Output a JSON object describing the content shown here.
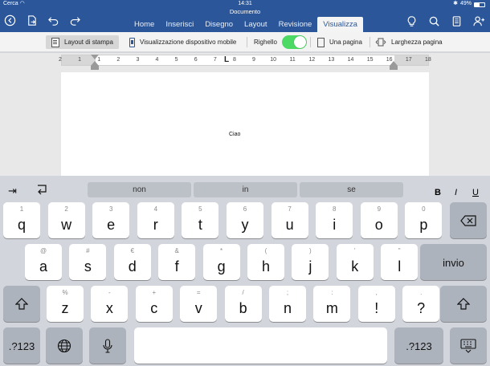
{
  "status": {
    "carrier": "Cerca",
    "time": "14:31",
    "battery": "49%"
  },
  "document": {
    "title": "Documento",
    "body_text": "Ciao"
  },
  "tabs": [
    {
      "label": "Home",
      "active": false
    },
    {
      "label": "Inserisci",
      "active": false
    },
    {
      "label": "Disegno",
      "active": false
    },
    {
      "label": "Layout",
      "active": false
    },
    {
      "label": "Revisione",
      "active": false
    },
    {
      "label": "Visualizza",
      "active": true
    }
  ],
  "ribbon": {
    "print_layout": "Layout di stampa",
    "mobile_view": "Visualizzazione dispositivo mobile",
    "ruler": "Righello",
    "ruler_on": true,
    "one_page": "Una pagina",
    "page_width": "Larghezza pagina"
  },
  "ruler_ticks": [
    "2",
    "1",
    "1",
    "2",
    "3",
    "4",
    "5",
    "6",
    "7",
    "8",
    "9",
    "10",
    "11",
    "12",
    "13",
    "14",
    "15",
    "16",
    "17",
    "18"
  ],
  "suggestions": [
    "non",
    "in",
    "se"
  ],
  "format_buttons": {
    "bold": "B",
    "italic": "I",
    "underline": "U"
  },
  "keys": {
    "row1": [
      {
        "main": "q",
        "alt": "1"
      },
      {
        "main": "w",
        "alt": "2"
      },
      {
        "main": "e",
        "alt": "3"
      },
      {
        "main": "r",
        "alt": "4"
      },
      {
        "main": "t",
        "alt": "5"
      },
      {
        "main": "y",
        "alt": "6"
      },
      {
        "main": "u",
        "alt": "7"
      },
      {
        "main": "i",
        "alt": "8"
      },
      {
        "main": "o",
        "alt": "9"
      },
      {
        "main": "p",
        "alt": "0"
      }
    ],
    "row2": [
      {
        "main": "a",
        "alt": "@"
      },
      {
        "main": "s",
        "alt": "#"
      },
      {
        "main": "d",
        "alt": "€"
      },
      {
        "main": "f",
        "alt": "&"
      },
      {
        "main": "g",
        "alt": "*"
      },
      {
        "main": "h",
        "alt": "("
      },
      {
        "main": "j",
        "alt": ")"
      },
      {
        "main": "k",
        "alt": "'"
      },
      {
        "main": "l",
        "alt": "\""
      }
    ],
    "row3": [
      {
        "main": "z",
        "alt": "%"
      },
      {
        "main": "x",
        "alt": "-"
      },
      {
        "main": "c",
        "alt": "+"
      },
      {
        "main": "v",
        "alt": "="
      },
      {
        "main": "b",
        "alt": "/"
      },
      {
        "main": "n",
        "alt": ";"
      },
      {
        "main": "m",
        "alt": ":"
      },
      {
        "main": "!",
        "alt": ","
      },
      {
        "main": "?",
        "alt": "."
      }
    ],
    "return_label": "invio",
    "numbers_label": ".?123"
  },
  "colors": {
    "accent": "#2b579a",
    "toggle_on": "#4cd964"
  }
}
